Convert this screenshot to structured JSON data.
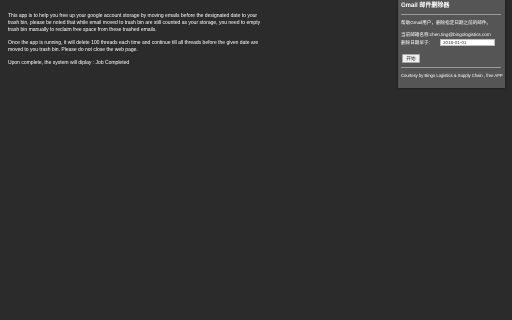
{
  "intro": {
    "paragraph1": "This app is to help you free up your google account storage by moving emails before the designated date to your trash bin, please be noted that while email moved to trash bin are still counted as your storage, you need to empty trash bin manually to reclaim free space from these trashed emails.",
    "paragraph2": "Once the app is running, it will delete 100 threads each time and continue till all threads before the given date are moved to you trash bin. Please do not close the web page.",
    "paragraph3": "Upon complete, the system will diplay : Job Completed"
  },
  "panel": {
    "title": "Gmail 邮件删除器",
    "instruction": "帮助Gmail用户，删除指定日期之前的邮件。",
    "account_label": "当前邮箱名称:",
    "account_value": "chen.ting@bingologistics.com",
    "date_label": "删除日期早于:",
    "date_value": "2016-01-01",
    "start_button": "开始",
    "credit": "Courtesy by Bingo Logistics & Supply Chain , free APP"
  }
}
